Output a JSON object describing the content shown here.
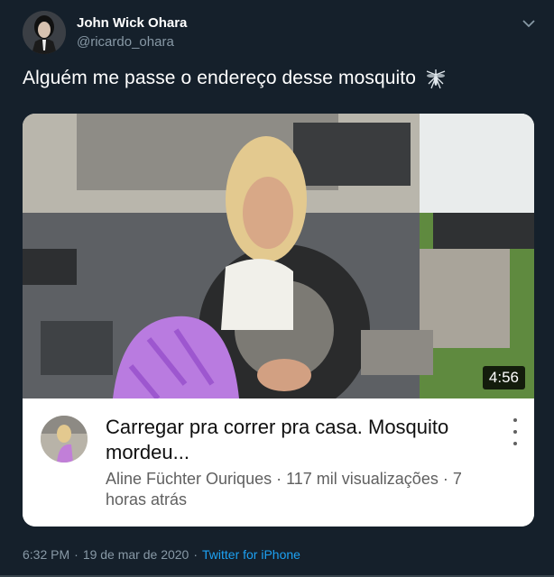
{
  "author": {
    "display_name": "John Wick Ohara",
    "handle": "@ricardo_ohara",
    "avatar_icon": "profile-avatar-icon"
  },
  "menu": {
    "icon": "chevron-down-icon"
  },
  "tweet": {
    "text": "Alguém me passe o endereço desse mosquito",
    "emoji_icon": "mosquito-emoji-icon"
  },
  "video_card": {
    "duration": "4:56",
    "title": "Carregar pra correr pra casa. Mosquito mordeu...",
    "meta": "Aline Füchter Ouriques · 117 mil visualizações · 7 horas atrás",
    "menu_icon": "more-vertical-icon"
  },
  "footer": {
    "time": "6:32 PM",
    "separator1": "·",
    "date": "19 de mar de 2020",
    "separator2": "·",
    "source": "Twitter for iPhone"
  },
  "colors": {
    "background": "#15202b",
    "secondary_text": "#8899a6",
    "link": "#1da1f2"
  }
}
